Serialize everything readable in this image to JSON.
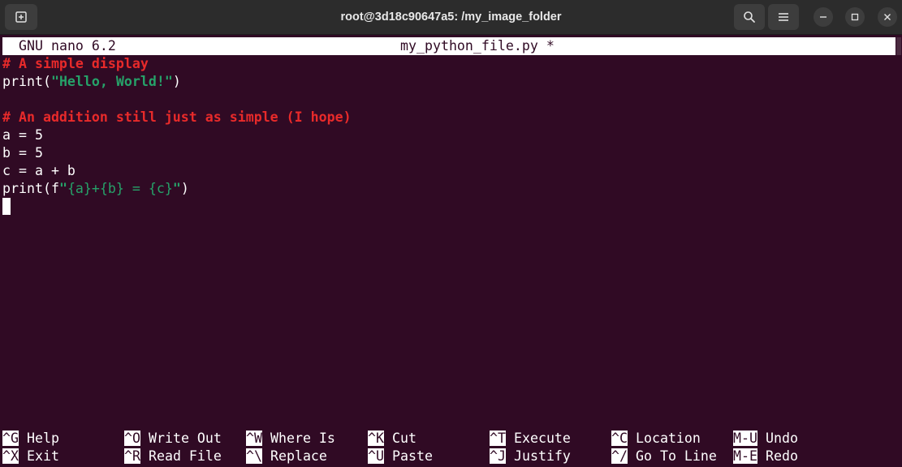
{
  "window": {
    "title": "root@3d18c90647a5: /my_image_folder",
    "icons": {
      "new_tab": "new-tab-icon",
      "search": "search-icon",
      "menu": "hamburger-menu-icon",
      "minimize": "minimize-icon",
      "maximize": "maximize-icon",
      "close": "close-icon"
    }
  },
  "nano": {
    "version": "GNU nano 6.2",
    "filename": "my_python_file.py *"
  },
  "code": {
    "line1_comment": "# A simple display",
    "line2_pre": "print(",
    "line2_str": "\"Hello, World!\"",
    "line2_post": ")",
    "line3": "",
    "line4_comment": "# An addition still just as simple (I hope)",
    "line5": "a = 5",
    "line6": "b = 5",
    "line7": "c = a + b",
    "line8_pre": "print(f",
    "line8_q1": "\"",
    "line8_fstr": "{a}+{b} = {c}",
    "line8_q2": "\"",
    "line8_post": ")"
  },
  "shortcuts": [
    {
      "key": "^G",
      "label": "Help"
    },
    {
      "key": "^O",
      "label": "Write Out"
    },
    {
      "key": "^W",
      "label": "Where Is"
    },
    {
      "key": "^K",
      "label": "Cut"
    },
    {
      "key": "^T",
      "label": "Execute"
    },
    {
      "key": "^C",
      "label": "Location"
    },
    {
      "key": "M-U",
      "label": "Undo"
    },
    {
      "key": "^X",
      "label": "Exit"
    },
    {
      "key": "^R",
      "label": "Read File"
    },
    {
      "key": "^\\",
      "label": "Replace"
    },
    {
      "key": "^U",
      "label": "Paste"
    },
    {
      "key": "^J",
      "label": "Justify"
    },
    {
      "key": "^/",
      "label": "Go To Line"
    },
    {
      "key": "M-E",
      "label": "Redo"
    }
  ],
  "colors": {
    "terminal_bg": "#300a24",
    "titlebar_bg": "#2c2c2c",
    "comment": "#e82a2a",
    "string": "#26a269",
    "text": "#ffffff"
  }
}
